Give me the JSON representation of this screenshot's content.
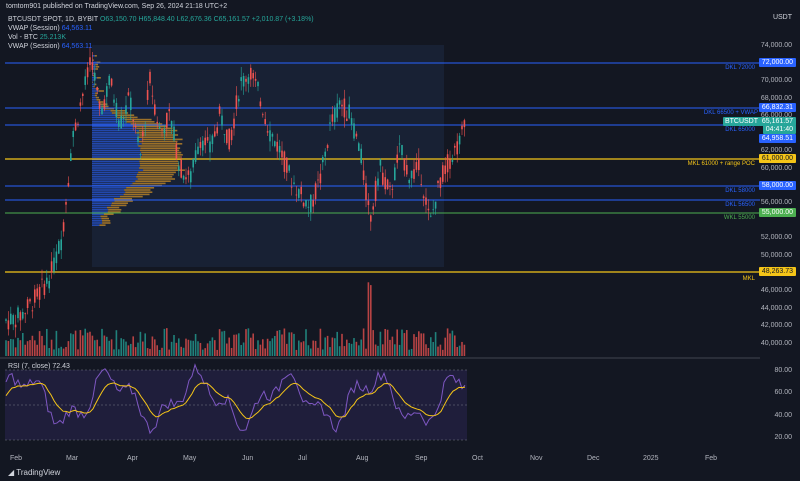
{
  "header": {
    "publisher_line": "tomtom901 published on TradingView.com, Sep 26, 2024 21:18 UTC+2",
    "currency": "USDT"
  },
  "legend": {
    "symbol_line": "BTCUSDT SPOT, 1D, BYBIT",
    "ohlc": "O63,150.70 H65,848.40 L62,676.36 C65,161.57 +2,010.87 (+3.18%)",
    "vwap1_label": "VWAP (Session)",
    "vwap1_value": "64,563.11",
    "vol_label": "Vol - BTC",
    "vol_value": "25.213K",
    "vwap2_label": "VWAP (Session)",
    "vwap2_value": "64,563.11"
  },
  "rsi_legend": "RSI (7, close) 72.43",
  "price_axis": [
    "74,000.00",
    "72,000.00",
    "70,000.00",
    "68,000.00",
    "66,000.00",
    "62,000.00",
    "60,000.00",
    "58,000.00",
    "56,000.00",
    "54,000.00",
    "52,000.00",
    "50,000.00",
    "48,000.00",
    "46,000.00",
    "44,000.00",
    "42,000.00",
    "40,000.00"
  ],
  "rsi_axis": [
    "80.00",
    "60.00",
    "40.00",
    "20.00"
  ],
  "months": [
    "Feb",
    "Mar",
    "Apr",
    "May",
    "Jun",
    "Jul",
    "Aug",
    "Sep",
    "Oct",
    "Nov",
    "Dec",
    "2025",
    "Feb"
  ],
  "levels": [
    {
      "label": "DKL 72000",
      "tag": "72,000.00",
      "color": "#2962ff"
    },
    {
      "label": "DKL 66500 + VWAP",
      "tag": "66,832.31",
      "color": "#2962ff"
    },
    {
      "label": "BTCUSDT",
      "tag": "65,161.57",
      "color": "#26a69a"
    },
    {
      "label": "",
      "tag": "04:41:40",
      "color": "#26a69a"
    },
    {
      "label": "DKL 65000",
      "tag": "64,958.51",
      "color": "#2962ff"
    },
    {
      "label": "MKL 61000 + range POC",
      "tag": "61,000.00",
      "color": "#f5c518"
    },
    {
      "label": "DKL 58000",
      "tag": "58,000.00",
      "color": "#2962ff"
    },
    {
      "label": "DKL 56500",
      "tag": "",
      "color": "#2962ff"
    },
    {
      "label": "WKL 55000",
      "tag": "55,000.00",
      "color": "#4caf50"
    },
    {
      "label": "MKL",
      "tag": "48,263.73",
      "color": "#f5c518"
    }
  ],
  "logo": "TradingView",
  "colors": {
    "bg": "#131722",
    "up": "#26a69a",
    "down": "#ef5350",
    "rsi": "#7e57c2",
    "rsi_ma": "#f5c518"
  }
}
